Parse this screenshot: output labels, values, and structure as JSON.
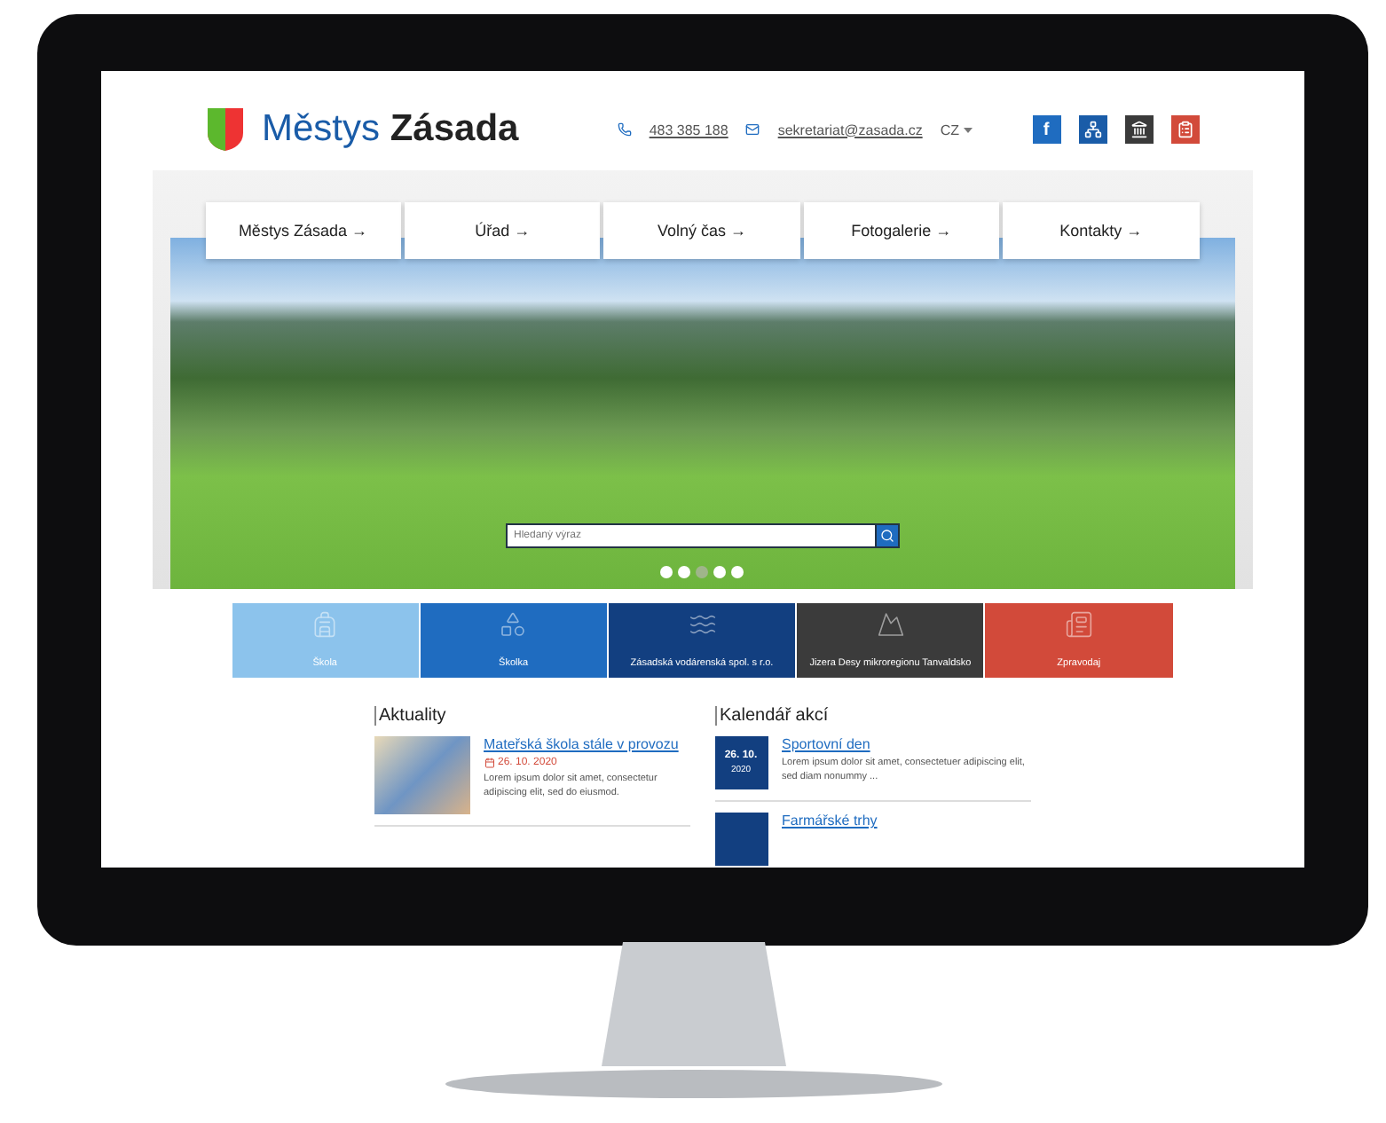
{
  "header": {
    "brand_light": "Městys",
    "brand_bold": "Zásada",
    "phone": "483 385 188",
    "email": "sekretariat@zasada.cz",
    "language": "CZ",
    "social": [
      {
        "kind": "facebook",
        "label": "f",
        "color": "#1f6cc0"
      },
      {
        "kind": "sitemap",
        "color": "#1a5ca8"
      },
      {
        "kind": "office",
        "color": "#3a3a3a"
      },
      {
        "kind": "board",
        "color": "#d24a3a"
      }
    ]
  },
  "nav": [
    {
      "label": "Městys Zásada →"
    },
    {
      "label": "Úřad →"
    },
    {
      "label": "Volný čas →"
    },
    {
      "label": "Fotogalerie →"
    },
    {
      "label": "Kontakty →"
    }
  ],
  "hero": {
    "search": {
      "placeholder": "Hledaný výraz"
    },
    "dots": [
      {
        "selected": false
      },
      {
        "selected": false
      },
      {
        "selected": true
      },
      {
        "selected": false
      },
      {
        "selected": false
      }
    ]
  },
  "tiles": [
    {
      "kind": "school",
      "label": "Škola",
      "color": "#8cc3ec"
    },
    {
      "kind": "kindergarten",
      "label": "Školka",
      "color": "#1f6cc0"
    },
    {
      "kind": "water",
      "label": "Zásadská vodárenská spol. s r.o.",
      "color": "#123f80"
    },
    {
      "kind": "mountains",
      "label": "Jizera Desy mikroregionu Tanvaldsko",
      "color": "#3b3b3b"
    },
    {
      "kind": "news",
      "label": "Zpravodaj",
      "color": "#d24a3a"
    }
  ],
  "news": {
    "heading": "Aktuality",
    "items": [
      {
        "title": "Mateřská škola stále v provozu",
        "date": "26. 10. 2020",
        "text": "Lorem ipsum dolor sit amet, consectetur adipiscing elit, sed do eiusmod."
      }
    ]
  },
  "events": {
    "heading": "Kalendář akcí",
    "items": [
      {
        "day": "26. 10.",
        "year": "2020",
        "title": "Sportovní den",
        "text": "Lorem ipsum dolor sit amet, consectetuer adipiscing elit, sed diam nonummy ..."
      },
      {
        "title": "Farmářské trhy"
      }
    ]
  }
}
